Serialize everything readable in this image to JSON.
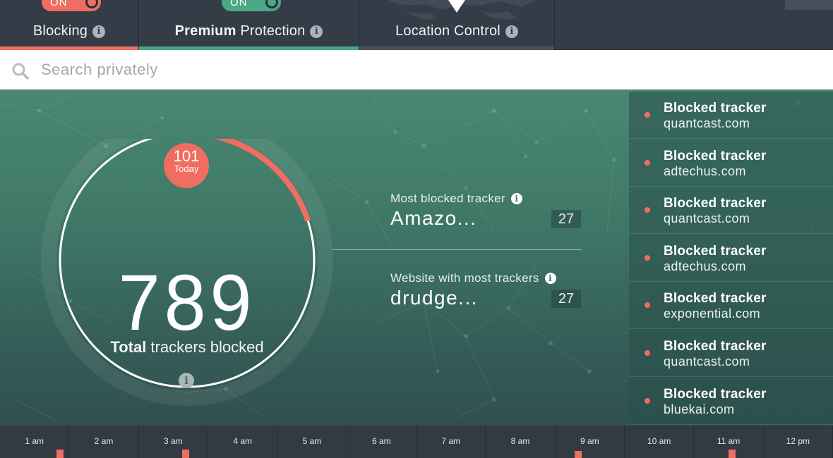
{
  "tabs": [
    {
      "label_bold": "",
      "label_rest": "Blocking",
      "toggle": "ON",
      "accent": "#ef6d61"
    },
    {
      "label_bold": "Premium",
      "label_rest": " Protection",
      "toggle": "ON",
      "accent": "#4aa884"
    },
    {
      "label_bold": "",
      "label_rest": "Location Control",
      "toggle": "",
      "accent": "#47515b"
    }
  ],
  "search": {
    "placeholder": "Search privately",
    "value": ""
  },
  "summary": {
    "total": "789",
    "total_label_bold": "Total",
    "total_label_rest": " trackers blocked",
    "today_count": "101",
    "today_label": "Today",
    "today_progress": 0.13
  },
  "stats": {
    "most_blocked": {
      "title": "Most blocked tracker",
      "value": "Amazo...",
      "count": "27"
    },
    "most_trackers_site": {
      "title": "Website with most trackers",
      "value": "drudge...",
      "count": "27"
    }
  },
  "trackers": [
    {
      "label": "Blocked tracker",
      "domain": "quantcast.com"
    },
    {
      "label": "Blocked tracker",
      "domain": "adtechus.com"
    },
    {
      "label": "Blocked tracker",
      "domain": "quantcast.com"
    },
    {
      "label": "Blocked tracker",
      "domain": "adtechus.com"
    },
    {
      "label": "Blocked tracker",
      "domain": "exponential.com"
    },
    {
      "label": "Blocked tracker",
      "domain": "quantcast.com"
    },
    {
      "label": "Blocked tracker",
      "domain": "bluekai.com"
    }
  ],
  "timeline": {
    "hours": [
      "1 am",
      "2 am",
      "3 am",
      "4 am",
      "5 am",
      "6 am",
      "7 am",
      "8 am",
      "9 am",
      "10 am",
      "11 am",
      "12 pm"
    ]
  },
  "colors": {
    "accent_red": "#ef6d61",
    "accent_green": "#4aa884",
    "panel": "#333c47"
  },
  "icons": {
    "info": "info-icon",
    "search": "search-icon",
    "pin": "location-pin-icon"
  }
}
